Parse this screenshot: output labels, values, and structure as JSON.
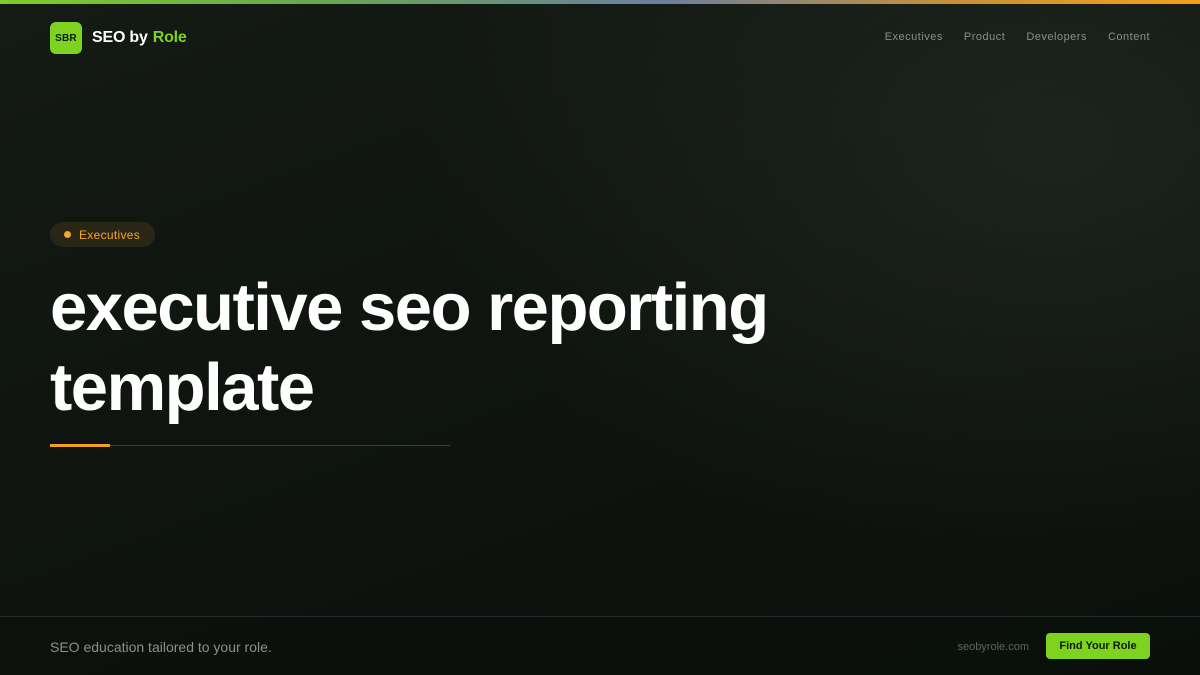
{
  "header": {
    "logo_text": "SBR",
    "brand_main": "SEO by",
    "brand_accent": "Role",
    "nav": [
      {
        "label": "Executives"
      },
      {
        "label": "Product"
      },
      {
        "label": "Developers"
      },
      {
        "label": "Content"
      }
    ]
  },
  "hero": {
    "badge_label": "Executives",
    "headline_line1": "executive seo reporting",
    "headline_line2": "template"
  },
  "footer": {
    "tagline": "SEO education tailored to your role.",
    "site_url": "seobyrole.com",
    "cta_label": "Find Your Role"
  },
  "colors": {
    "accent_green": "#7ed321",
    "accent_orange": "#f5a623",
    "background": "#0e120e"
  },
  "icons": {
    "badge_dot": "dot-icon"
  }
}
